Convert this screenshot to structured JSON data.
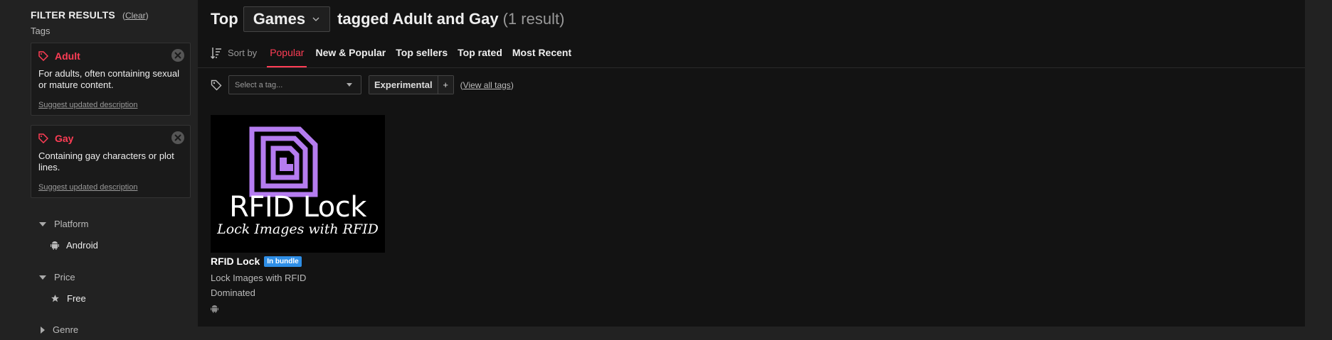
{
  "sidebar": {
    "title": "FILTER RESULTS",
    "clear_label": "Clear",
    "tags_label": "Tags",
    "tag_cards": [
      {
        "name": "Adult",
        "description": "For adults, often containing sexual or mature content.",
        "suggest": "Suggest updated description"
      },
      {
        "name": "Gay",
        "description": "Containing gay characters or plot lines.",
        "suggest": "Suggest updated description"
      }
    ],
    "facets": {
      "platform": {
        "label": "Platform",
        "item": "Android",
        "item_icon": "android-icon"
      },
      "price": {
        "label": "Price",
        "item": "Free",
        "item_icon": "star-icon"
      },
      "genre": {
        "label": "Genre"
      }
    }
  },
  "header": {
    "prefix": "Top",
    "type_select": "Games",
    "tagged": "tagged Adult and Gay",
    "result_count": "(1 result)"
  },
  "sort": {
    "label": "Sort by",
    "tabs": [
      "Popular",
      "New & Popular",
      "Top sellers",
      "Top rated",
      "Most Recent"
    ],
    "active": "Popular"
  },
  "tag_filter": {
    "placeholder": "Select a tag...",
    "experimental": "Experimental",
    "plus": "+",
    "view_all": "View all tags"
  },
  "game": {
    "thumb_title": "RFID Lock",
    "thumb_subtitle": "Lock Images with RFID",
    "title": "RFID Lock",
    "badge": "In bundle",
    "description": "Lock Images with RFID",
    "author": "Dominated",
    "platform_icon": "android-icon"
  },
  "colors": {
    "accent": "#ff3d55",
    "badge": "#2e8ee6",
    "thumb_purple": "#b57cf0"
  }
}
